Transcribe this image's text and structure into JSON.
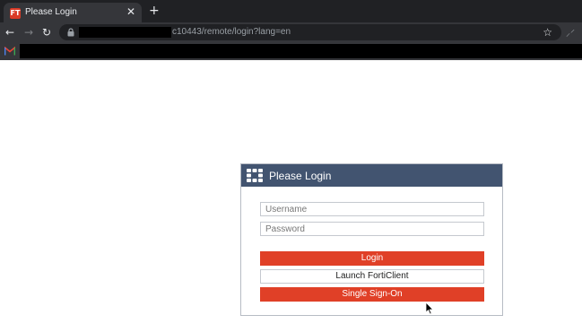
{
  "browser": {
    "tab": {
      "title": "Please Login",
      "favicon_text": "FT",
      "close": "✕"
    },
    "new_tab": "+",
    "nav": {
      "back": "←",
      "forward": "→",
      "reload": "↻"
    },
    "url_visible": "c10443/remote/login?lang=en",
    "star": "☆",
    "extension": "⸝⸍",
    "colors": {
      "tabstrip": "#202124",
      "toolbar": "#35363a"
    }
  },
  "login": {
    "title": "Please Login",
    "username_placeholder": "Username",
    "password_placeholder": "Password",
    "username_value": "",
    "password_value": "",
    "login_label": "Login",
    "forticlient_label": "Launch FortiClient",
    "sso_label": "Single Sign-On",
    "colors": {
      "header": "#425470",
      "primary_button": "#e04027"
    }
  }
}
